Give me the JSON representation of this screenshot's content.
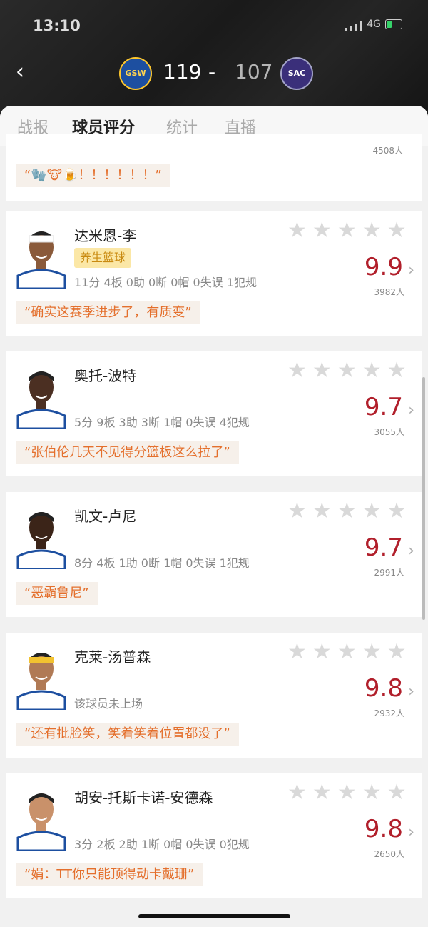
{
  "status": {
    "time": "13:10",
    "network": "4G"
  },
  "match": {
    "home_abbr": "GSW",
    "home_score": "119",
    "separator": "-",
    "away_abbr": "SAC",
    "away_score": "107",
    "home_color": "#1d4fa0",
    "away_color": "#3a2f7a"
  },
  "tabs": [
    {
      "label": "战报"
    },
    {
      "label": "球员评分",
      "active": true
    },
    {
      "label": "统计"
    },
    {
      "label": "直播"
    }
  ],
  "partial_card": {
    "count": "4508人",
    "comment": "“🧤🐮🍺！！！！！！”"
  },
  "players": [
    {
      "name": "达米恩-李",
      "badge": "养生篮球",
      "stats": "11分 4板 0助 0断 0帽 0失误 1犯规",
      "rating": "9.9",
      "count": "3982人",
      "comment": "“确实这赛季进步了，有质变”",
      "headband": "white",
      "skin": "#8a5a3a"
    },
    {
      "name": "奥托-波特",
      "stats": "5分 9板 3助 3断 1帽 0失误 4犯规",
      "rating": "9.7",
      "count": "3055人",
      "comment": "“张伯伦几天不见得分篮板这么拉了”",
      "skin": "#4b2f22"
    },
    {
      "name": "凯文-卢尼",
      "stats": "8分 4板 1助 0断 1帽 0失误 1犯规",
      "rating": "9.7",
      "count": "2991人",
      "comment": "“恶霸鲁尼”",
      "skin": "#3b2418"
    },
    {
      "name": "克莱-汤普森",
      "stats": "该球员未上场",
      "rating": "9.8",
      "count": "2932人",
      "comment": "“还有批脸笑，笑着笑着位置都没了”",
      "headband": "yellow",
      "skin": "#b07a55"
    },
    {
      "name": "胡安-托斯卡诺-安德森",
      "stats": "3分 2板 2助 1断 0帽 0失误 0犯规",
      "rating": "9.8",
      "count": "2650人",
      "comment": "“娟：TT你只能顶得动卡戴珊”",
      "skin": "#c9916a"
    }
  ],
  "colors": {
    "accent": "#c41e2e",
    "rating": "#b11f2b",
    "comment": "#e46f2c"
  },
  "icons": {
    "back": "chevron-left-icon",
    "star": "star-icon",
    "chevron": "chevron-right-icon"
  }
}
